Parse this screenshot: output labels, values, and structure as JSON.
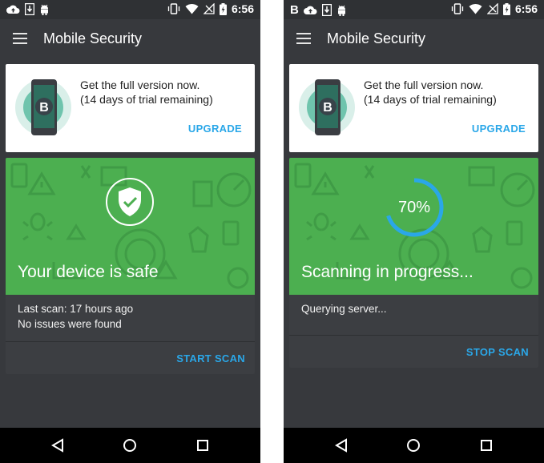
{
  "left": {
    "status_bar": {
      "time": "6:56"
    },
    "app_bar": {
      "title": "Mobile Security"
    },
    "promo": {
      "logo_letter": "B",
      "line1": "Get the full version now.",
      "line2": "(14 days of trial remaining)",
      "upgrade_label": "UPGRADE"
    },
    "status": {
      "headline": "Your device is safe",
      "detail1": "Last scan: 17 hours ago",
      "detail2": "No issues were found",
      "action_label": "START SCAN"
    }
  },
  "right": {
    "status_bar": {
      "time": "6:56",
      "b_label": "B"
    },
    "app_bar": {
      "title": "Mobile Security"
    },
    "promo": {
      "logo_letter": "B",
      "line1": "Get the full version now.",
      "line2": "(14 days of trial remaining)",
      "upgrade_label": "UPGRADE"
    },
    "status": {
      "progress_text": "70%",
      "progress_fraction": 0.7,
      "headline": "Scanning in progress...",
      "detail1": "Querying server...",
      "action_label": "STOP SCAN"
    }
  },
  "colors": {
    "accent": "#2aa7e8",
    "green": "#4caf50",
    "dark": "#37393d",
    "progress_ring": "#2aa7e8"
  },
  "icons": [
    "cloud-upload-icon",
    "download-icon",
    "android-icon",
    "vibrate-icon",
    "wifi-icon",
    "no-signal-icon",
    "battery-charging-icon",
    "menu-icon",
    "back-icon",
    "home-icon",
    "recents-icon",
    "shield-check-icon"
  ]
}
